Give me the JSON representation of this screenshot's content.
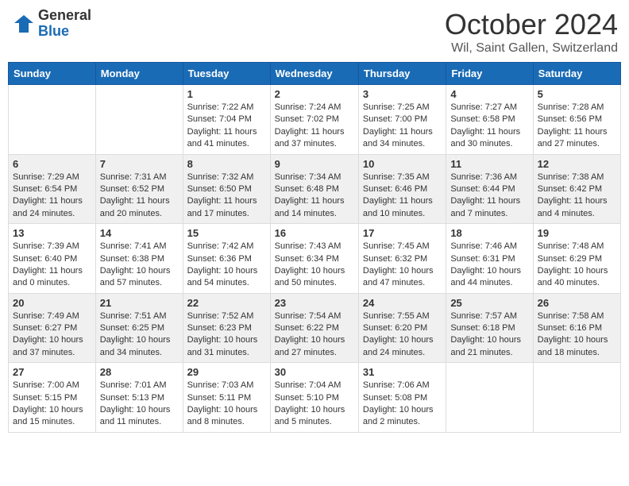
{
  "header": {
    "logo_general": "General",
    "logo_blue": "Blue",
    "month_title": "October 2024",
    "location": "Wil, Saint Gallen, Switzerland"
  },
  "weekdays": [
    "Sunday",
    "Monday",
    "Tuesday",
    "Wednesday",
    "Thursday",
    "Friday",
    "Saturday"
  ],
  "weeks": [
    [
      {
        "day": "",
        "info": ""
      },
      {
        "day": "",
        "info": ""
      },
      {
        "day": "1",
        "info": "Sunrise: 7:22 AM\nSunset: 7:04 PM\nDaylight: 11 hours and 41 minutes."
      },
      {
        "day": "2",
        "info": "Sunrise: 7:24 AM\nSunset: 7:02 PM\nDaylight: 11 hours and 37 minutes."
      },
      {
        "day": "3",
        "info": "Sunrise: 7:25 AM\nSunset: 7:00 PM\nDaylight: 11 hours and 34 minutes."
      },
      {
        "day": "4",
        "info": "Sunrise: 7:27 AM\nSunset: 6:58 PM\nDaylight: 11 hours and 30 minutes."
      },
      {
        "day": "5",
        "info": "Sunrise: 7:28 AM\nSunset: 6:56 PM\nDaylight: 11 hours and 27 minutes."
      }
    ],
    [
      {
        "day": "6",
        "info": "Sunrise: 7:29 AM\nSunset: 6:54 PM\nDaylight: 11 hours and 24 minutes."
      },
      {
        "day": "7",
        "info": "Sunrise: 7:31 AM\nSunset: 6:52 PM\nDaylight: 11 hours and 20 minutes."
      },
      {
        "day": "8",
        "info": "Sunrise: 7:32 AM\nSunset: 6:50 PM\nDaylight: 11 hours and 17 minutes."
      },
      {
        "day": "9",
        "info": "Sunrise: 7:34 AM\nSunset: 6:48 PM\nDaylight: 11 hours and 14 minutes."
      },
      {
        "day": "10",
        "info": "Sunrise: 7:35 AM\nSunset: 6:46 PM\nDaylight: 11 hours and 10 minutes."
      },
      {
        "day": "11",
        "info": "Sunrise: 7:36 AM\nSunset: 6:44 PM\nDaylight: 11 hours and 7 minutes."
      },
      {
        "day": "12",
        "info": "Sunrise: 7:38 AM\nSunset: 6:42 PM\nDaylight: 11 hours and 4 minutes."
      }
    ],
    [
      {
        "day": "13",
        "info": "Sunrise: 7:39 AM\nSunset: 6:40 PM\nDaylight: 11 hours and 0 minutes."
      },
      {
        "day": "14",
        "info": "Sunrise: 7:41 AM\nSunset: 6:38 PM\nDaylight: 10 hours and 57 minutes."
      },
      {
        "day": "15",
        "info": "Sunrise: 7:42 AM\nSunset: 6:36 PM\nDaylight: 10 hours and 54 minutes."
      },
      {
        "day": "16",
        "info": "Sunrise: 7:43 AM\nSunset: 6:34 PM\nDaylight: 10 hours and 50 minutes."
      },
      {
        "day": "17",
        "info": "Sunrise: 7:45 AM\nSunset: 6:32 PM\nDaylight: 10 hours and 47 minutes."
      },
      {
        "day": "18",
        "info": "Sunrise: 7:46 AM\nSunset: 6:31 PM\nDaylight: 10 hours and 44 minutes."
      },
      {
        "day": "19",
        "info": "Sunrise: 7:48 AM\nSunset: 6:29 PM\nDaylight: 10 hours and 40 minutes."
      }
    ],
    [
      {
        "day": "20",
        "info": "Sunrise: 7:49 AM\nSunset: 6:27 PM\nDaylight: 10 hours and 37 minutes."
      },
      {
        "day": "21",
        "info": "Sunrise: 7:51 AM\nSunset: 6:25 PM\nDaylight: 10 hours and 34 minutes."
      },
      {
        "day": "22",
        "info": "Sunrise: 7:52 AM\nSunset: 6:23 PM\nDaylight: 10 hours and 31 minutes."
      },
      {
        "day": "23",
        "info": "Sunrise: 7:54 AM\nSunset: 6:22 PM\nDaylight: 10 hours and 27 minutes."
      },
      {
        "day": "24",
        "info": "Sunrise: 7:55 AM\nSunset: 6:20 PM\nDaylight: 10 hours and 24 minutes."
      },
      {
        "day": "25",
        "info": "Sunrise: 7:57 AM\nSunset: 6:18 PM\nDaylight: 10 hours and 21 minutes."
      },
      {
        "day": "26",
        "info": "Sunrise: 7:58 AM\nSunset: 6:16 PM\nDaylight: 10 hours and 18 minutes."
      }
    ],
    [
      {
        "day": "27",
        "info": "Sunrise: 7:00 AM\nSunset: 5:15 PM\nDaylight: 10 hours and 15 minutes."
      },
      {
        "day": "28",
        "info": "Sunrise: 7:01 AM\nSunset: 5:13 PM\nDaylight: 10 hours and 11 minutes."
      },
      {
        "day": "29",
        "info": "Sunrise: 7:03 AM\nSunset: 5:11 PM\nDaylight: 10 hours and 8 minutes."
      },
      {
        "day": "30",
        "info": "Sunrise: 7:04 AM\nSunset: 5:10 PM\nDaylight: 10 hours and 5 minutes."
      },
      {
        "day": "31",
        "info": "Sunrise: 7:06 AM\nSunset: 5:08 PM\nDaylight: 10 hours and 2 minutes."
      },
      {
        "day": "",
        "info": ""
      },
      {
        "day": "",
        "info": ""
      }
    ]
  ]
}
